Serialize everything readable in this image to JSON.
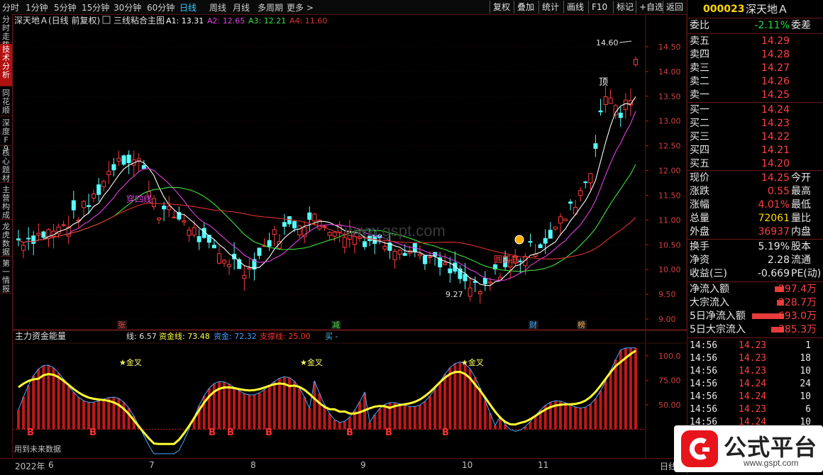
{
  "toolbar": {
    "periods": [
      "分时",
      "1分钟",
      "5分钟",
      "15分钟",
      "30分钟",
      "60分钟",
      "日线",
      "周线",
      "月线",
      "多周期",
      "更多 >"
    ],
    "active_period": "日线",
    "right_buttons": [
      "复权",
      "叠加",
      "统计",
      "画线",
      "F10",
      "标记",
      "+自选",
      "返回"
    ]
  },
  "left_tabs": [
    "分时走势",
    "技术分析",
    "同花顺",
    "深度F9",
    "核心题材",
    "主营构成",
    "龙虎数据",
    "第一情报"
  ],
  "header": {
    "stock_name": "深天地Ａ(日线 前复权)",
    "indicator": "三线粘合主图",
    "a1": "A1: 13.31",
    "a2": "A2: 12.65",
    "a3": "A3: 12.21",
    "a4": "A4: 11.60"
  },
  "price_axis": [
    "14.50",
    "14.00",
    "13.50",
    "13.00",
    "12.50",
    "12.00",
    "11.50",
    "11.00",
    "10.50",
    "10.00",
    "9.50",
    "9.00"
  ],
  "annotations": {
    "high": "14.60",
    "low": "9.27",
    "top": "顶",
    "cross_four": "穿四线",
    "arc_bottom": "圆弧底",
    "watermark": "www.gspt.com"
  },
  "event_marks": [
    "张",
    "减",
    "财",
    "榜"
  ],
  "sub": {
    "title": "主力资金能量",
    "line": "线: 6.57",
    "fund_line": "资金线: 73.48",
    "fund": "资金: 72.32",
    "support": "支撑线: 25.00",
    "buy": "买 -",
    "axis": [
      "100.0",
      "75.00",
      "50.00"
    ],
    "gold_cross": "★金叉",
    "buy_mark": "B",
    "future_data": "用到未来数据"
  },
  "x_axis": {
    "year": "2022年",
    "months": [
      "6",
      "7",
      "8",
      "9",
      "10",
      "11"
    ],
    "right_label": "日线"
  },
  "chart_data": {
    "type": "candlestick",
    "ylim": [
      8.8,
      14.9
    ],
    "ma_labels": [
      "A1",
      "A2",
      "A3",
      "A4"
    ],
    "last_values": {
      "A1": 13.31,
      "A2": 12.65,
      "A3": 12.21,
      "A4": 11.6
    },
    "high": 14.6,
    "low": 9.27
  },
  "sidebar": {
    "code": "000023",
    "name": "深天地Ａ",
    "weibi_label": "委比",
    "weibi": "-2.11%",
    "weicha_label": "委差",
    "asks": [
      {
        "label": "卖五",
        "price": "14.29"
      },
      {
        "label": "卖四",
        "price": "14.28"
      },
      {
        "label": "卖三",
        "price": "14.27"
      },
      {
        "label": "卖二",
        "price": "14.26"
      },
      {
        "label": "卖一",
        "price": "14.25"
      }
    ],
    "bids": [
      {
        "label": "买一",
        "price": "14.24"
      },
      {
        "label": "买二",
        "price": "14.23"
      },
      {
        "label": "买三",
        "price": "14.22"
      },
      {
        "label": "买四",
        "price": "14.21"
      },
      {
        "label": "买五",
        "price": "14.20"
      }
    ],
    "quote": [
      {
        "label": "现价",
        "value": "14.25",
        "label2": "今开",
        "cls": "red"
      },
      {
        "label": "涨跌",
        "value": "0.55",
        "label2": "最高",
        "cls": "red"
      },
      {
        "label": "涨幅",
        "value": "4.01%",
        "label2": "最低",
        "cls": "red"
      },
      {
        "label": "总量",
        "value": "72061",
        "label2": "量比",
        "cls": "yellow"
      },
      {
        "label": "外盘",
        "value": "36937",
        "label2": "内盘",
        "cls": "red"
      }
    ],
    "stats": [
      {
        "label": "换手",
        "value": "5.19%",
        "label2": "股本"
      },
      {
        "label": "净资",
        "value": "2.28",
        "label2": "流通"
      },
      {
        "label": "收益(三)",
        "value": "-0.669",
        "label2": "PE(动)"
      }
    ],
    "flows": [
      {
        "label": "净流入额",
        "value": "297.4万",
        "bar": 0.25
      },
      {
        "label": "大宗流入",
        "value": "228.7万",
        "bar": 0.2
      },
      {
        "label": "5日净流入额",
        "value": "693.0万",
        "bar": 0.9
      },
      {
        "label": "5日大宗流入",
        "value": "385.3万",
        "bar": 0.35
      }
    ],
    "ticks": [
      {
        "time": "14:56",
        "price": "14.23",
        "vol": "1"
      },
      {
        "time": "14:56",
        "price": "14.23",
        "vol": "18"
      },
      {
        "time": "14:56",
        "price": "14.23",
        "vol": "10"
      },
      {
        "time": "14:56",
        "price": "14.24",
        "vol": "24"
      },
      {
        "time": "14:56",
        "price": "14.24",
        "vol": "10"
      },
      {
        "time": "14:56",
        "price": "14.23",
        "vol": "6"
      },
      {
        "time": "14:56",
        "price": "14.24",
        "vol": "10"
      }
    ]
  },
  "logo": {
    "text": "公式平台",
    "url_text": "www.gspt.com"
  }
}
